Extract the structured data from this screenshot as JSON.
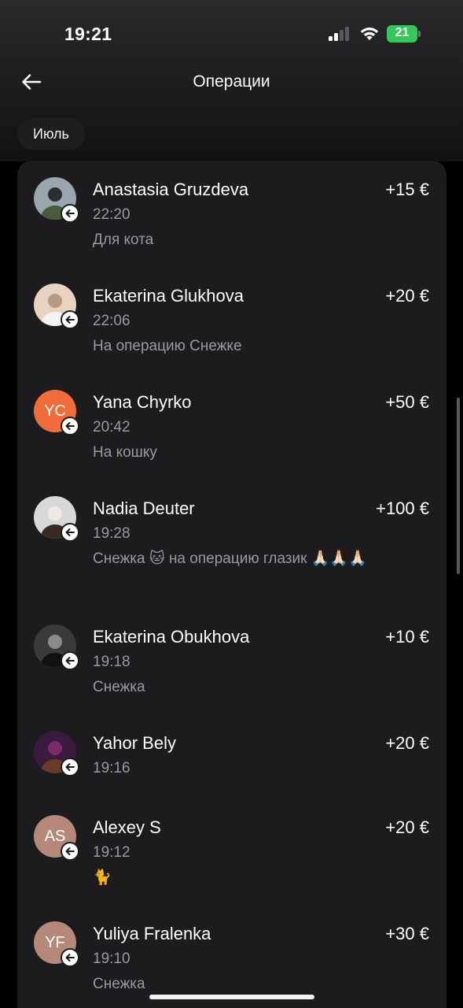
{
  "status_bar": {
    "time": "19:21",
    "battery": "21"
  },
  "header": {
    "title": "Операции",
    "back_icon": "arrow-left-icon"
  },
  "filter": {
    "month": "Июль"
  },
  "colors": {
    "background": "#000000",
    "card": "#1c1c1e",
    "secondary_text": "#9a9a9e",
    "battery": "#34c759"
  },
  "operations": [
    {
      "name": "Anastasia Gruzdeva",
      "amount": "+15 €",
      "time": "22:20",
      "comment": "Для кота",
      "avatar": "photo"
    },
    {
      "name": "Ekaterina Glukhova",
      "amount": "+20 €",
      "time": "22:06",
      "comment": "На операцию Снежке",
      "avatar": "photo"
    },
    {
      "name": "Yana Chyrko",
      "amount": "+50 €",
      "time": "20:42",
      "comment": "На кошку",
      "avatar": "initials",
      "initials": "YC",
      "avatar_color": "#f26b3a"
    },
    {
      "name": "Nadia Deuter",
      "amount": "+100 €",
      "time": "19:28",
      "comment": "Снежка 🐱 на операцию глазик 🙏🏻🙏🏻🙏🏻",
      "avatar": "photo"
    },
    {
      "name": "Ekaterina Obukhova",
      "amount": "+10 €",
      "time": "19:18",
      "comment": "Снежка",
      "avatar": "photo"
    },
    {
      "name": "Yahor Bely",
      "amount": "+20 €",
      "time": "19:16",
      "comment": "",
      "avatar": "photo"
    },
    {
      "name": "Alexey S",
      "amount": "+20 €",
      "time": "19:12",
      "comment": "🐈",
      "avatar": "initials",
      "initials": "AS",
      "avatar_color": "#b6887a"
    },
    {
      "name": "Yuliya Fralenka",
      "amount": "+30 €",
      "time": "19:10",
      "comment": "Снежка",
      "avatar": "initials",
      "initials": "YF",
      "avatar_color": "#b6887a"
    }
  ]
}
